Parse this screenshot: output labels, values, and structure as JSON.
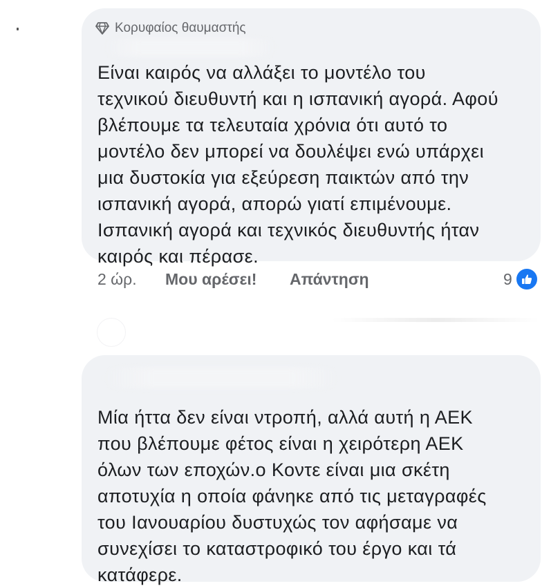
{
  "comments": [
    {
      "badge": "Κορυφαίος θαυμαστής",
      "lines": [
        "Είναι καιρός να αλλάξει το μοντέλο του",
        "τεχνικού διευθυντή και η ισπανική αγορά. Αφού",
        "βλέπουμε τα τελευταία χρόνια ότι αυτό το",
        "μοντέλο δεν μπορεί να δουλέψει ενώ υπάρχει",
        "μια δυστοκία για εξεύρεση παικτών από την",
        "ισπανική αγορά, απορώ γιατί επιμένουμε.",
        "Ισπανική αγορά και τεχνικός διευθυντής ήταν",
        "καιρός και πέρασε."
      ],
      "time": "2 ώρ.",
      "like_label": "Μου αρέσει!",
      "reply_label": "Απάντηση",
      "reaction_count": "9",
      "reaction_icon": "thumbs-up-icon"
    },
    {
      "lines": [
        "Μία ήττα δεν είναι ντροπή, αλλά αυτή η ΑΕΚ",
        "που βλέπουμε φέτος είναι η χειρότερη ΑΕΚ",
        "όλων των εποχών.ο Κοντε είναι μια σκέτη",
        "αποτυχία η οποία φάνηκε από τις μεταγραφές",
        "του Ιανουαρίου δυστυχώς τον αφήσαμε να",
        "συνεχίσει το καταστροφικό του έργο και τά",
        "κατάφερε."
      ]
    }
  ],
  "colors": {
    "bubble": "#f0f2f5",
    "secondary_text": "#65676b",
    "like_blue": "#1877f2"
  }
}
